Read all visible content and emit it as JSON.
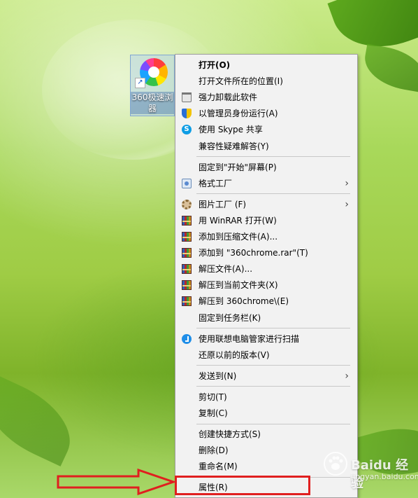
{
  "desktop": {
    "shortcut": {
      "label": "360极速浏览器",
      "label_line1": "360极速浏",
      "label_line2": "器"
    }
  },
  "context_menu": {
    "groups": [
      [
        {
          "label": "打开(O)",
          "bold": true
        },
        {
          "label": "打开文件所在的位置(I)"
        },
        {
          "label": "强力卸载此软件",
          "icon": "trash-icon"
        },
        {
          "label": "以管理员身份运行(A)",
          "icon": "shield-icon"
        },
        {
          "label": "使用 Skype 共享",
          "icon": "skype-icon"
        },
        {
          "label": "兼容性疑难解答(Y)"
        }
      ],
      [
        {
          "label": "固定到\"开始\"屏幕(P)"
        },
        {
          "label": "格式工厂",
          "icon": "format-factory-icon",
          "submenu": true
        }
      ],
      [
        {
          "label": "图片工厂 (F)",
          "icon": "picture-factory-icon",
          "submenu": true
        },
        {
          "label": "用 WinRAR 打开(W)",
          "icon": "winrar-icon"
        },
        {
          "label": "添加到压缩文件(A)...",
          "icon": "winrar-icon"
        },
        {
          "label": "添加到 \"360chrome.rar\"(T)",
          "icon": "winrar-icon"
        },
        {
          "label": "解压文件(A)...",
          "icon": "winrar-icon"
        },
        {
          "label": "解压到当前文件夹(X)",
          "icon": "winrar-icon"
        },
        {
          "label": "解压到 360chrome\\(E)",
          "icon": "winrar-icon"
        },
        {
          "label": "固定到任务栏(K)"
        }
      ],
      [
        {
          "label": "使用联想电脑管家进行扫描",
          "icon": "lenovo-icon"
        },
        {
          "label": "还原以前的版本(V)"
        }
      ],
      [
        {
          "label": "发送到(N)",
          "submenu": true
        }
      ],
      [
        {
          "label": "剪切(T)"
        },
        {
          "label": "复制(C)"
        }
      ],
      [
        {
          "label": "创建快捷方式(S)"
        },
        {
          "label": "删除(D)"
        },
        {
          "label": "重命名(M)"
        }
      ],
      [
        {
          "label": "属性(R)",
          "highlighted": true
        }
      ]
    ]
  },
  "watermark": {
    "main": "Baidu 经验",
    "sub": "jingyan.baidu.com"
  },
  "colors": {
    "highlight": "#e01f1f",
    "menu_bg": "#f2f2f2"
  }
}
